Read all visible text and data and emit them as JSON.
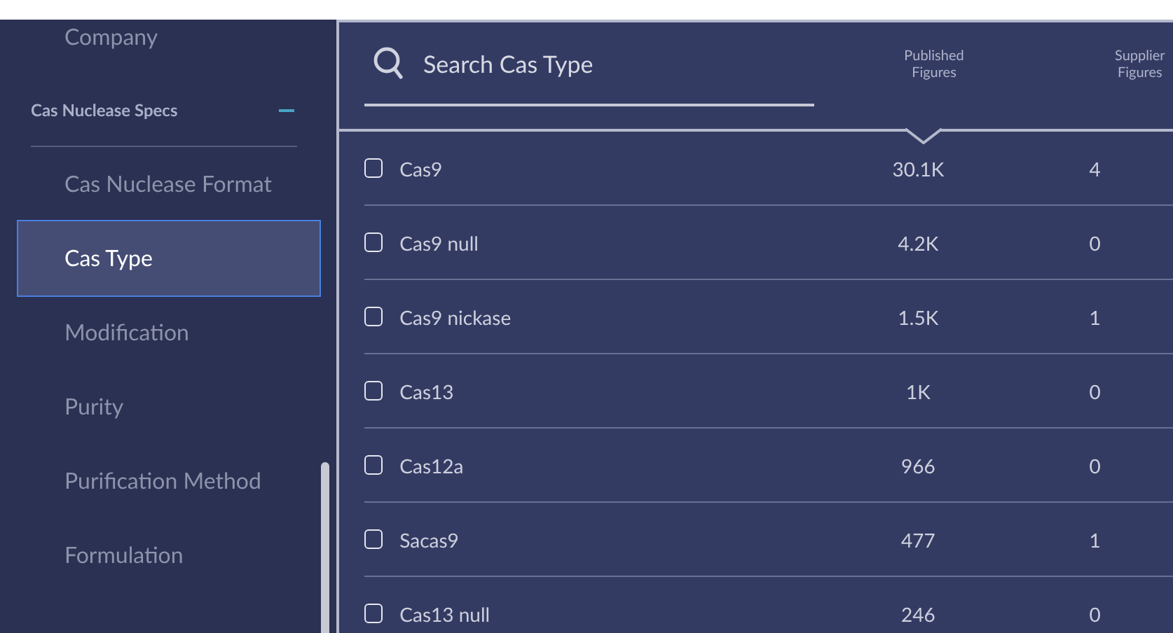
{
  "sidebar": {
    "items": [
      {
        "kind": "item",
        "label": "Company",
        "selected": false
      },
      {
        "kind": "section",
        "label": "Cas Nuclease Specs",
        "expanded": true
      },
      {
        "kind": "item",
        "label": "Cas Nuclease Format",
        "selected": false
      },
      {
        "kind": "item",
        "label": "Cas Type",
        "selected": true
      },
      {
        "kind": "item",
        "label": "Modification",
        "selected": false
      },
      {
        "kind": "item",
        "label": "Purity",
        "selected": false
      },
      {
        "kind": "item",
        "label": "Purification Method",
        "selected": false
      },
      {
        "kind": "item",
        "label": "Formulation",
        "selected": false
      }
    ]
  },
  "filter": {
    "search": {
      "placeholder": "Search Cas Type"
    },
    "columns": [
      "Published Figures",
      "Supplier Figures"
    ],
    "rows": [
      {
        "label": "Cas9",
        "published": "30.1K",
        "supplier": "4",
        "checked": false
      },
      {
        "label": "Cas9 null",
        "published": "4.2K",
        "supplier": "0",
        "checked": false
      },
      {
        "label": "Cas9 nickase",
        "published": "1.5K",
        "supplier": "1",
        "checked": false
      },
      {
        "label": "Cas13",
        "published": "1K",
        "supplier": "0",
        "checked": false
      },
      {
        "label": "Cas12a",
        "published": "966",
        "supplier": "0",
        "checked": false
      },
      {
        "label": "Sacas9",
        "published": "477",
        "supplier": "1",
        "checked": false
      },
      {
        "label": "Cas13 null",
        "published": "246",
        "supplier": "0",
        "checked": false
      }
    ]
  }
}
